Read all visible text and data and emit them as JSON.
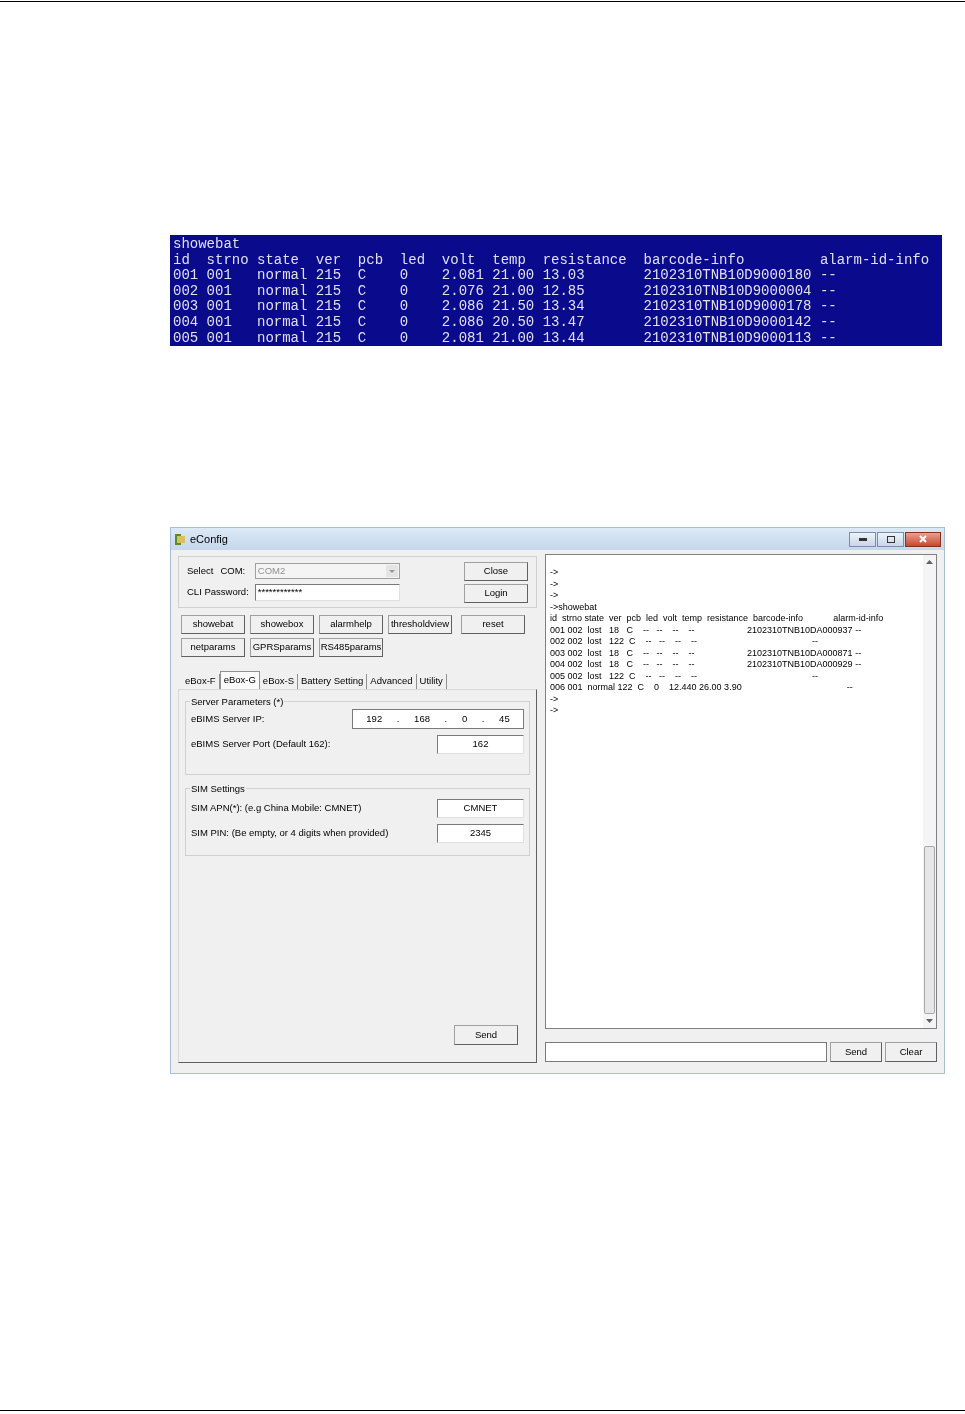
{
  "terminal": {
    "lines": [
      "showebat",
      "id  strno state  ver  pcb  led  volt  temp  resistance  barcode-info         alarm-id-info",
      "001 001   normal 215  C    0    2.081 21.00 13.03       2102310TNB10D9000180 --",
      "002 001   normal 215  C    0    2.076 21.00 12.85       2102310TNB10D9000004 --",
      "003 001   normal 215  C    0    2.086 21.50 13.34       2102310TNB10D9000178 --",
      "004 001   normal 215  C    0    2.086 20.50 13.47       2102310TNB10D9000142 --",
      "005 001   normal 215  C    0    2.081 21.00 13.44       2102310TNB10D9000113 --"
    ]
  },
  "window": {
    "title": "eConfig"
  },
  "connection": {
    "select_label": "Select",
    "com_label": "COM:",
    "com_value": "COM2",
    "com_disabled": true,
    "password_label": "CLI Password:",
    "password_value": "************"
  },
  "connection_buttons": [
    "Close",
    "Login"
  ],
  "command_buttons": [
    [
      "showebat",
      "showebox",
      "alarmhelp",
      "thresholdview",
      "reset"
    ],
    [
      "netparams",
      "GPRSparams",
      "RS485params"
    ]
  ],
  "tabs": [
    {
      "label": "eBox-F",
      "selected": false
    },
    {
      "label": "eBox-G",
      "selected": true
    },
    {
      "label": "eBox-S",
      "selected": false
    },
    {
      "label": "Battery Setting",
      "selected": false
    },
    {
      "label": "Advanced",
      "selected": false
    },
    {
      "label": "Utility",
      "selected": false
    }
  ],
  "server_group": {
    "title": "Server Parameters (*)",
    "ip_label": "eBIMS Server IP:",
    "ip_parts": [
      "192",
      ".",
      "168",
      ".",
      "0",
      ".",
      "45"
    ],
    "port_label": "eBIMS Server Port (Default 162):",
    "port": "162"
  },
  "sim_group": {
    "title": "SIM Settings",
    "apn_label": "SIM APN(*): (e.g China Mobile: CMNET)",
    "apn": "CMNET",
    "pin_label": "SIM PIN:  (Be empty, or 4 digits when provided)",
    "pin": "2345"
  },
  "tab_send": "Send",
  "console": {
    "lines": [
      "->",
      "->",
      "->",
      "->showebat",
      "id  strno state  ver  pcb  led  volt  temp  resistance  barcode-info            alarm-id-info",
      "001 002  lost   18   C    --   --    --    --                     2102310TNB10DA000937 --",
      "002 002  lost   122  C    --   --    --    --                                              --",
      "003 002  lost   18   C    --   --    --    --                     2102310TNB10DA000871 --",
      "004 002  lost   18   C    --   --    --    --                     2102310TNB10DA000929 --",
      "005 002  lost   122  C    --   --    --    --                                              --",
      "006 001  normal 122  C    0    12.440 26.00 3.90                                          --",
      "->",
      "->"
    ]
  },
  "console_buttons": [
    "Send",
    "Clear"
  ]
}
